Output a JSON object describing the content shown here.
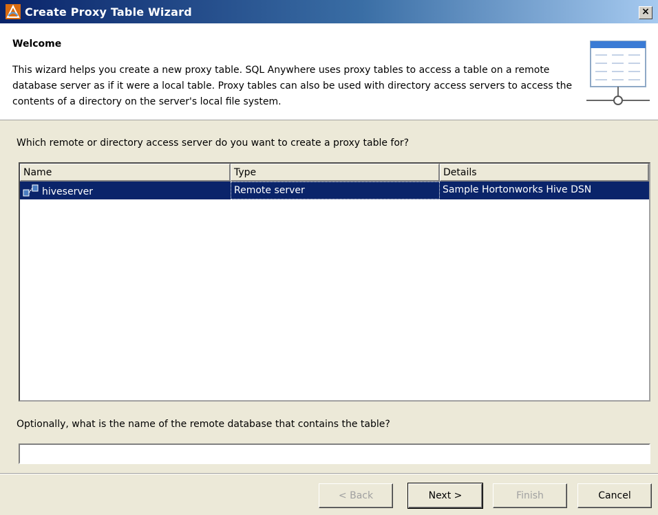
{
  "window": {
    "title": "Create Proxy Table Wizard",
    "close_label": "×"
  },
  "header": {
    "title": "Welcome",
    "description": "This wizard helps you create a new proxy table. SQL Anywhere uses proxy tables to access a table on a remote database server as if it were a local table. Proxy tables can also be used with directory access servers to access the contents of a directory on the server's local file system."
  },
  "question1": "Which remote or directory access server do you want to create a proxy table for?",
  "table": {
    "columns": [
      "Name",
      "Type",
      "Details"
    ],
    "rows": [
      {
        "name": "hiveserver",
        "type": "Remote server",
        "details": "Sample Hortonworks Hive DSN",
        "icon": "server-icon"
      }
    ]
  },
  "question2": "Optionally, what is the name of the remote database that contains the table?",
  "database_input": {
    "value": "",
    "placeholder": ""
  },
  "buttons": {
    "back": "< Back",
    "next": "Next >",
    "finish": "Finish",
    "cancel": "Cancel"
  },
  "colors": {
    "selection": "#0a246a",
    "title_bar": "#0a246a",
    "dialog_bg": "#ece9d8"
  }
}
